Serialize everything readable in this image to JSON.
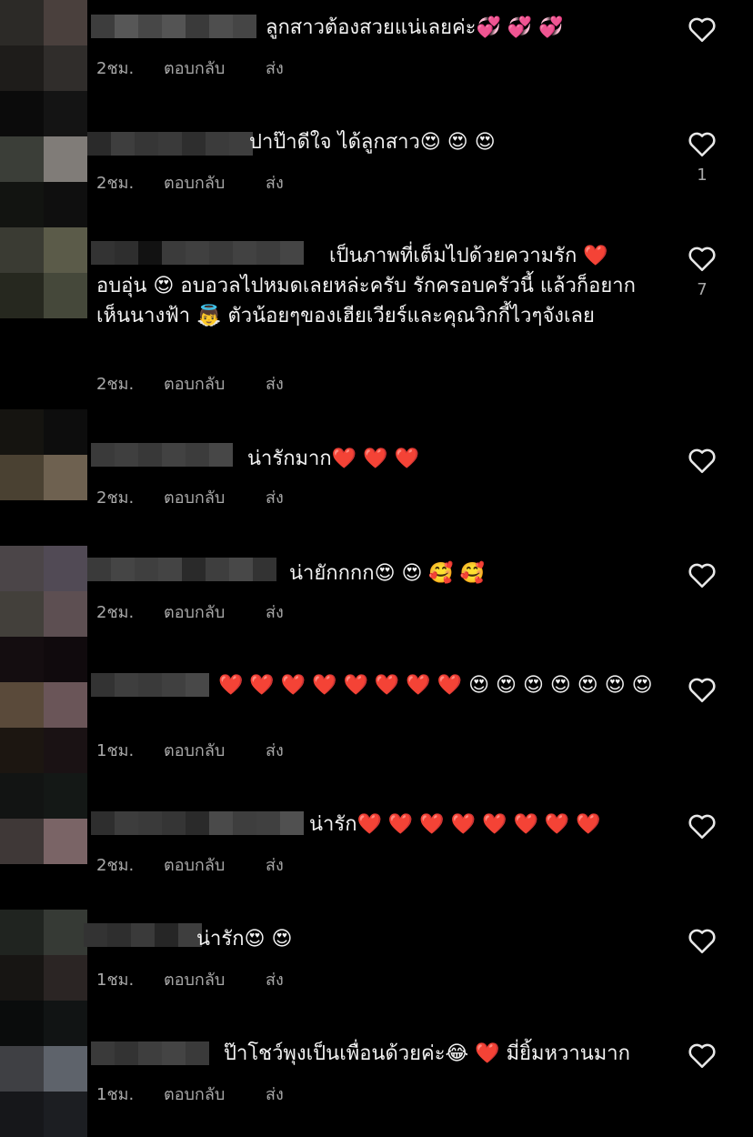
{
  "labels": {
    "reply": "ตอบกลับ",
    "send": "ส่ง"
  },
  "colors": {
    "background": "#000000",
    "text": "#f2f2f2",
    "meta": "#a8a8a8",
    "heart": "#e62b2b"
  },
  "comments": [
    {
      "text": "ลูกสาวต้องสวยแน่เลยค่ะ💞 💞 💞",
      "time": "2ชม.",
      "likes": ""
    },
    {
      "text": "ปาป๊าดีใจ ได้ลูกสาว😍 😍 😍",
      "time": "2ชม.",
      "likes": "1"
    },
    {
      "text": "เป็นภาพที่เต็มไปด้วยความรัก ❤️ อบอุ่น 😍 อบอวลไปหมดเลยหล่ะครับ รักครอบครัวนี้ แล้วก็อยากเห็นนางฟ้า 👼 ตัวน้อยๆของเฮียเวียร์และคุณวิกกี้ไวๆจังเลย",
      "time": "2ชม.",
      "likes": "7"
    },
    {
      "text": "น่ารักมาก❤️ ❤️ ❤️",
      "time": "2ชม.",
      "likes": ""
    },
    {
      "text": "น่ายักกกก😍 😍 🥰 🥰",
      "time": "2ชม.",
      "likes": ""
    },
    {
      "text": "❤️ ❤️ ❤️ ❤️ ❤️ ❤️ ❤️ ❤️ 😍 😍 😍 😍 😍 😍 😍",
      "time": "1ชม.",
      "likes": ""
    },
    {
      "text": "น่ารัก❤️ ❤️ ❤️ ❤️ ❤️ ❤️ ❤️ ❤️",
      "time": "2ชม.",
      "likes": ""
    },
    {
      "text": "น่ารัก😍 😍",
      "time": "1ชม.",
      "likes": ""
    },
    {
      "text": "ป๊าโชว์พุงเป็นเพื่อนด้วยค่ะ😂 ❤️ มี่ยิ้มหวานมาก",
      "time": "1ชม.",
      "likes": ""
    }
  ]
}
